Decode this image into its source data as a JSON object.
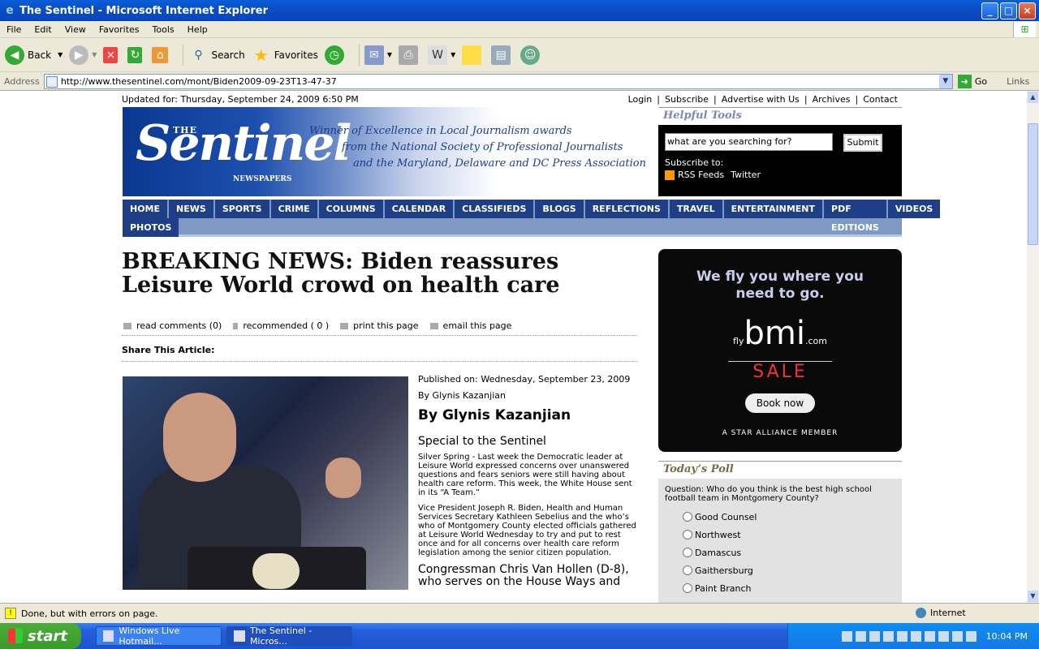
{
  "window": {
    "title": "The Sentinel - Microsoft Internet Explorer",
    "menus": [
      "File",
      "Edit",
      "View",
      "Favorites",
      "Tools",
      "Help"
    ],
    "toolbar": {
      "back": "Back",
      "search": "Search",
      "favorites": "Favorites"
    },
    "address_label": "Address",
    "address": "http://www.thesentinel.com/mont/Biden2009-09-23T13-47-37",
    "go": "Go",
    "links": "Links",
    "status": "Done, but with errors on page.",
    "zone": "Internet"
  },
  "taskbar": {
    "start": "start",
    "tasks": [
      "Windows Live Hotmail...",
      "The Sentinel - Micros..."
    ],
    "clock": "10:04 PM"
  },
  "page": {
    "updated": "Updated for:  Thursday, September 24, 2009 6:50 PM",
    "top_links": [
      "Login",
      "Subscribe",
      "Advertise with Us",
      "Archives",
      "Contact"
    ],
    "logo": {
      "the": "THE",
      "name": "Sentinel",
      "sub": "NEWSPAPERS"
    },
    "award": [
      "Winner of Excellence in Local Journalism awards",
      "from the National Society of Professional Journalists",
      "and the Maryland, Delaware and DC Press Association"
    ],
    "helpful_tools": {
      "title": "Helpful Tools",
      "search_placeholder": "what are you searching for?",
      "submit": "Submit",
      "subscribe": "Subscribe to:",
      "rss": "RSS Feeds",
      "twitter": "Twitter"
    },
    "nav_row1": [
      "HOME",
      "NEWS",
      "SPORTS",
      "CRIME",
      "COLUMNS",
      "CALENDAR",
      "CLASSIFIEDS",
      "BLOGS",
      "REFLECTIONS",
      "TRAVEL",
      "ENTERTAINMENT",
      "PDF EDITIONS",
      "VIDEOS"
    ],
    "nav_row2": [
      "PHOTOS"
    ],
    "headline": "BREAKING NEWS: Biden reassures Leisure World crowd on health care",
    "tools": [
      "read comments (0)",
      "recommended ( 0 )",
      "print this page",
      "email this page"
    ],
    "share": "Share This Article:",
    "article": {
      "published": "Published on: Wednesday, September 23, 2009",
      "byline_small": "By Glynis Kazanjian",
      "byline_big": "By Glynis Kazanjian",
      "special": "Special to the Sentinel",
      "p1": "Silver Spring - Last week the Democratic leader at Leisure World expressed concerns over unanswered questions and fears seniors were still having about health care reform.  This week, the White House sent in its “A Team.”",
      "p2": "Vice President Joseph R. Biden, Health and Human Services Secretary Kathleen Sebelius and the who’s who of Montgomery County elected officials gathered at Leisure World Wednesday to try and put to rest once and for all concerns over health care reform legislation among the senior citizen population.",
      "p3": "Congressman Chris Van Hollen (D-8), who serves on the House Ways and"
    },
    "ad": {
      "line1": "We fly you where you",
      "line2": "need to go.",
      "fly": "fly",
      "bmi": "bmi",
      ".com": ".com",
      "sale": "SALE",
      "book": "Book now",
      "star": "A STAR ALLIANCE MEMBER"
    },
    "poll": {
      "title": "Today’s Poll",
      "question": "Question: Who do you think is the best high school football team in Montgomery County?",
      "options": [
        "Good Counsel",
        "Northwest",
        "Damascus",
        "Gaithersburg",
        "Paint Branch"
      ]
    }
  }
}
